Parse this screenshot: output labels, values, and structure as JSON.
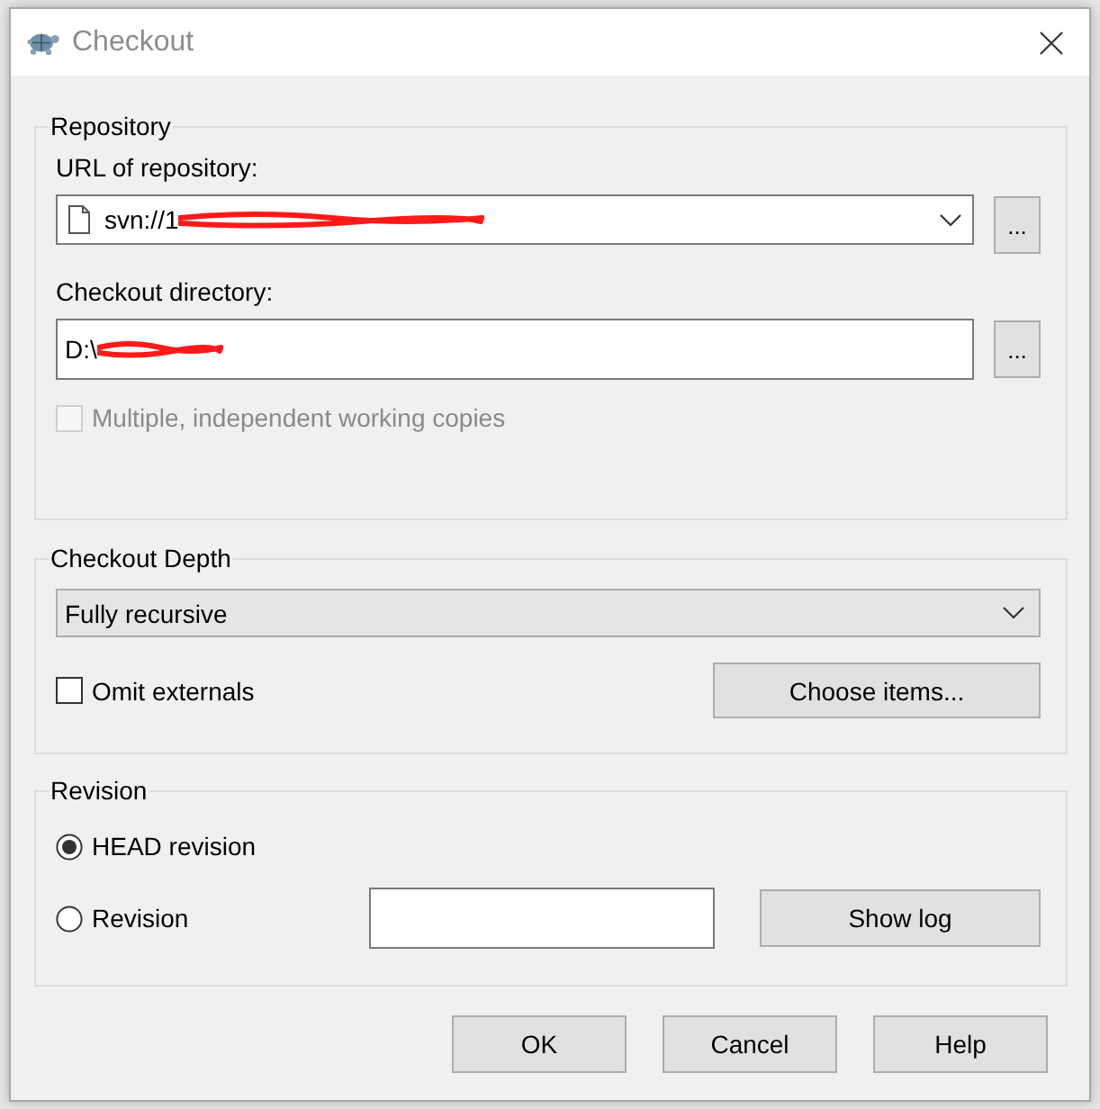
{
  "window": {
    "title": "Checkout"
  },
  "repository": {
    "title": "Repository",
    "url_label": "URL of repository:",
    "url": {
      "value": "svn://1",
      "redacted": true
    },
    "browse_url": "...",
    "directory_label": "Checkout directory:",
    "directory": {
      "value": "D:\\",
      "redacted": true
    },
    "browse_directory": "...",
    "multiple_copies": {
      "label": "Multiple, independent working copies",
      "checked": false,
      "disabled": true
    }
  },
  "depth": {
    "title": "Checkout Depth",
    "value": "Fully recursive",
    "omit_externals": {
      "label": "Omit externals",
      "checked": false,
      "disabled": false
    },
    "choose_items": "Choose items..."
  },
  "revision": {
    "title": "Revision",
    "options": [
      {
        "label": "HEAD revision",
        "selected": true
      },
      {
        "label": "Revision",
        "selected": false
      }
    ],
    "show_log": "Show log"
  },
  "buttons": [
    "OK",
    "Cancel",
    "Help"
  ]
}
